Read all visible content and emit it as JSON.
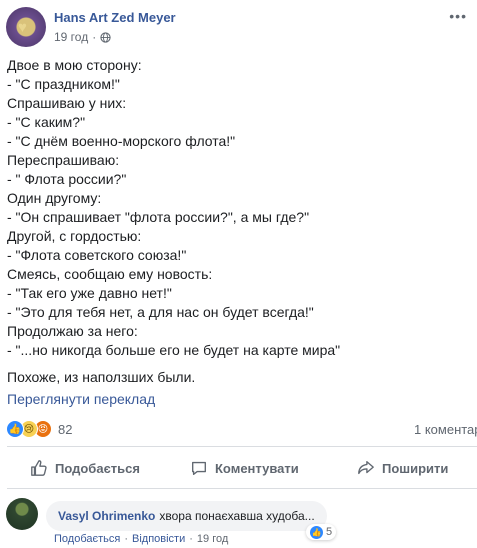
{
  "post": {
    "author": "Hans Art Zed Meyer",
    "timestamp": "19 год",
    "separator": "·",
    "lines": [
      "Двое в мою сторону:",
      "- \"С праздником!\"",
      "Спрашиваю у них:",
      "- \"С каким?\"",
      "- \"С днём военно-морского флота!\"",
      "Переспрашиваю:",
      "- \" Флота россии?\"",
      "Один другому:",
      "- \"Он спрашивает \"флота россии?\", а мы где?\"",
      "Другой, с гордостью:",
      "- \"Флота советского союза!\"",
      "Смеясь, сообщаю ему новость:",
      "- \"Так его уже давно нет!\"",
      "- \"Это для тебя нет, а для нас он будет всегда!\"",
      "Продолжаю за него:",
      "- \"...но никогда больше его не будет на карте мира\""
    ],
    "final_line": "Похоже, из наползших были.",
    "translate_link": "Переглянути переклад",
    "reactions": {
      "icons": [
        "like-icon",
        "sad-icon",
        "angry-icon"
      ],
      "count": "82"
    },
    "comment_count": "1 коментар"
  },
  "actions": {
    "like": "Подобається",
    "comment": "Коментувати",
    "share": "Поширити"
  },
  "comment": {
    "author": "Vasyl Ohrimenko",
    "text": "хвора понаєхавша худоба...",
    "likes": "5",
    "like_label": "Подобається",
    "reply_label": "Відповісти",
    "time": "19 год",
    "separator": "·"
  },
  "colors": {
    "link": "#385898",
    "like_blue": "#2d88ff",
    "text_secondary": "#606770"
  }
}
